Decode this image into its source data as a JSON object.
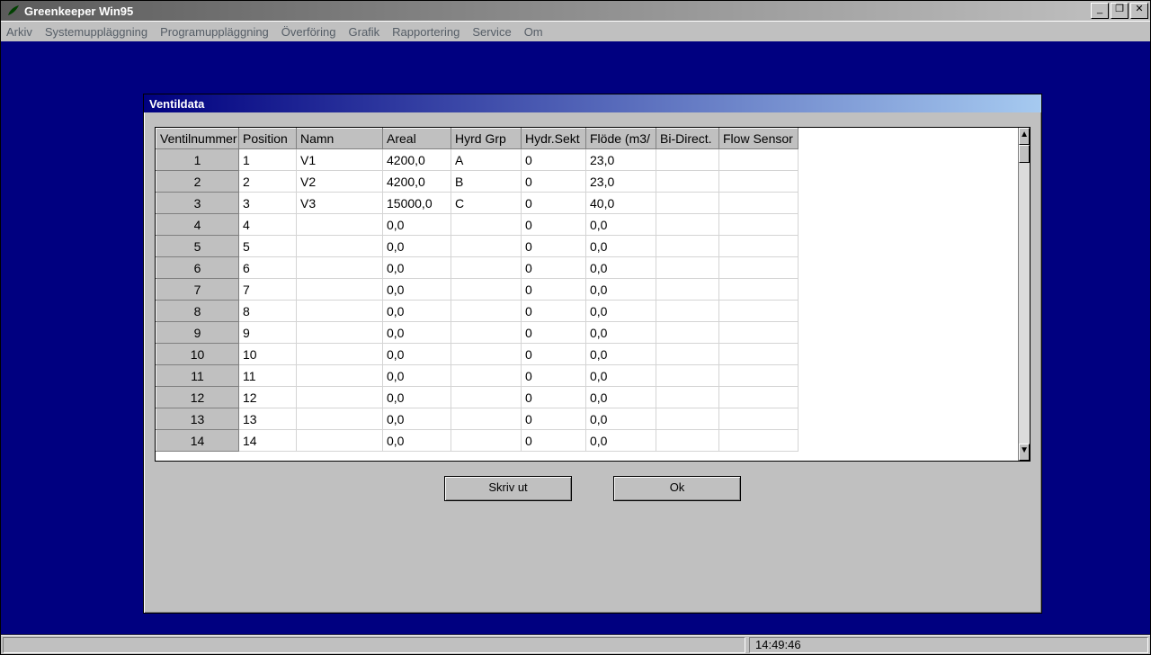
{
  "app": {
    "title": "Greenkeeper Win95",
    "window_buttons": {
      "min": "_",
      "max": "❐",
      "close": "✕"
    }
  },
  "menu": [
    "Arkiv",
    "Systemuppläggning",
    "Programuppläggning",
    "Överföring",
    "Grafik",
    "Rapportering",
    "Service",
    "Om"
  ],
  "dialog": {
    "title": "Ventildata",
    "columns": [
      "Ventilnummer",
      "Position",
      "Namn",
      "Areal",
      "Hyrd Grp",
      "Hydr.Sekt",
      "Flöde (m3/",
      "Bi-Direct.",
      "Flow Sensor"
    ],
    "rows": [
      {
        "num": "1",
        "pos": "1",
        "name": "V1",
        "areal": "4200,0",
        "grp": "A",
        "sekt": "0",
        "flow": "23,0",
        "bi": "",
        "sensor": ""
      },
      {
        "num": "2",
        "pos": "2",
        "name": "V2",
        "areal": "4200,0",
        "grp": "B",
        "sekt": "0",
        "flow": "23,0",
        "bi": "",
        "sensor": ""
      },
      {
        "num": "3",
        "pos": "3",
        "name": "V3",
        "areal": "15000,0",
        "grp": "C",
        "sekt": "0",
        "flow": "40,0",
        "bi": "",
        "sensor": ""
      },
      {
        "num": "4",
        "pos": "4",
        "name": "",
        "areal": "0,0",
        "grp": "",
        "sekt": "0",
        "flow": "0,0",
        "bi": "",
        "sensor": ""
      },
      {
        "num": "5",
        "pos": "5",
        "name": "",
        "areal": "0,0",
        "grp": "",
        "sekt": "0",
        "flow": "0,0",
        "bi": "",
        "sensor": ""
      },
      {
        "num": "6",
        "pos": "6",
        "name": "",
        "areal": "0,0",
        "grp": "",
        "sekt": "0",
        "flow": "0,0",
        "bi": "",
        "sensor": ""
      },
      {
        "num": "7",
        "pos": "7",
        "name": "",
        "areal": "0,0",
        "grp": "",
        "sekt": "0",
        "flow": "0,0",
        "bi": "",
        "sensor": ""
      },
      {
        "num": "8",
        "pos": "8",
        "name": "",
        "areal": "0,0",
        "grp": "",
        "sekt": "0",
        "flow": "0,0",
        "bi": "",
        "sensor": ""
      },
      {
        "num": "9",
        "pos": "9",
        "name": "",
        "areal": "0,0",
        "grp": "",
        "sekt": "0",
        "flow": "0,0",
        "bi": "",
        "sensor": ""
      },
      {
        "num": "10",
        "pos": "10",
        "name": "",
        "areal": "0,0",
        "grp": "",
        "sekt": "0",
        "flow": "0,0",
        "bi": "",
        "sensor": ""
      },
      {
        "num": "11",
        "pos": "11",
        "name": "",
        "areal": "0,0",
        "grp": "",
        "sekt": "0",
        "flow": "0,0",
        "bi": "",
        "sensor": ""
      },
      {
        "num": "12",
        "pos": "12",
        "name": "",
        "areal": "0,0",
        "grp": "",
        "sekt": "0",
        "flow": "0,0",
        "bi": "",
        "sensor": ""
      },
      {
        "num": "13",
        "pos": "13",
        "name": "",
        "areal": "0,0",
        "grp": "",
        "sekt": "0",
        "flow": "0,0",
        "bi": "",
        "sensor": ""
      },
      {
        "num": "14",
        "pos": "14",
        "name": "",
        "areal": "0,0",
        "grp": "",
        "sekt": "0",
        "flow": "0,0",
        "bi": "",
        "sensor": ""
      }
    ],
    "buttons": {
      "print": "Skriv ut",
      "ok": "Ok"
    }
  },
  "status": {
    "clock": "14:49:46"
  }
}
